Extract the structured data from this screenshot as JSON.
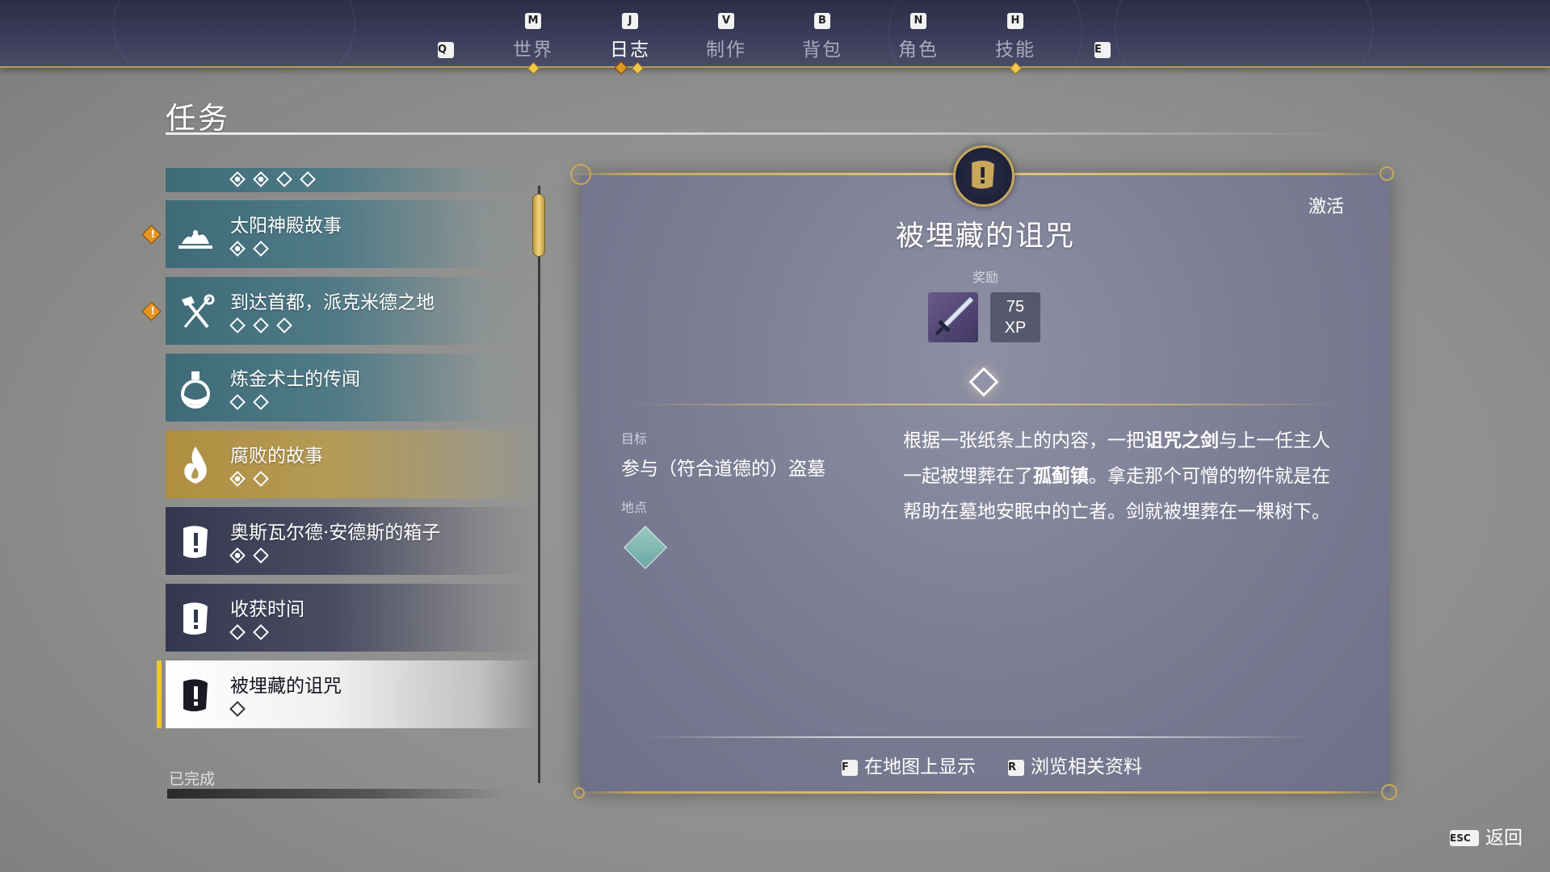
{
  "nav": {
    "left_key": "Q",
    "right_key": "E",
    "tabs": [
      {
        "key": "M",
        "label": "世界"
      },
      {
        "key": "J",
        "label": "日志"
      },
      {
        "key": "V",
        "label": "制作"
      },
      {
        "key": "B",
        "label": "背包"
      },
      {
        "key": "N",
        "label": "角色"
      },
      {
        "key": "H",
        "label": "技能"
      }
    ],
    "active_tab": "日志"
  },
  "page": {
    "title": "任务"
  },
  "quests": [
    {
      "name": "太阳神殿故事",
      "icon": "temple-icon",
      "style": "teal",
      "alert": true,
      "objectives": [
        "filled",
        "empty"
      ]
    },
    {
      "name": "到达首都，派克米德之地",
      "icon": "crossed-tools-icon",
      "style": "teal",
      "alert": true,
      "objectives": [
        "empty",
        "empty",
        "empty"
      ]
    },
    {
      "name": "炼金术士的传闻",
      "icon": "potion-flask-icon",
      "style": "teal",
      "alert": false,
      "objectives": [
        "empty",
        "empty"
      ]
    },
    {
      "name": "腐败的故事",
      "icon": "flame-icon",
      "style": "gold",
      "alert": false,
      "objectives": [
        "filled",
        "empty"
      ]
    },
    {
      "name": "奥斯瓦尔德·安德斯的箱子",
      "icon": "scroll-alert-icon",
      "style": "dark",
      "alert": false,
      "objectives": [
        "filled",
        "empty"
      ]
    },
    {
      "name": "收获时间",
      "icon": "scroll-alert-icon",
      "style": "dark",
      "alert": false,
      "objectives": [
        "empty",
        "empty"
      ]
    },
    {
      "name": "被埋藏的诅咒",
      "icon": "scroll-alert-icon",
      "style": "selected",
      "alert": false,
      "objectives": [
        "empty"
      ]
    }
  ],
  "alert_glyph": "!",
  "completed_label": "已完成",
  "detail": {
    "status": "激活",
    "title": "被埋藏的诅咒",
    "reward_label": "奖励",
    "reward_item_icon": "sword-icon",
    "xp_value": "75",
    "xp_unit": "XP",
    "objective_label": "目标",
    "objective_text": "参与（符合道德的）盗墓",
    "location_label": "地点",
    "location_icon": "graveyard-marker-icon",
    "description_parts": [
      "根据一张纸条上的内容，一把",
      "诅咒之剑",
      "与上一任主人一起被埋葬在了",
      "孤蓟镇",
      "。拿走那个可憎的物件就是在帮助在墓地安眠中的亡者。剑就被埋葬在一棵树下。"
    ]
  },
  "actions": [
    {
      "key": "F",
      "label": "在地图上显示"
    },
    {
      "key": "R",
      "label": "浏览相关资料"
    }
  ],
  "back": {
    "key": "ESC",
    "label": "返回"
  },
  "colors": {
    "accent_gold": "#f2c531",
    "alert_orange": "#e8951f",
    "teal_row": "#4f7a86",
    "panel": "#7c7d93"
  }
}
